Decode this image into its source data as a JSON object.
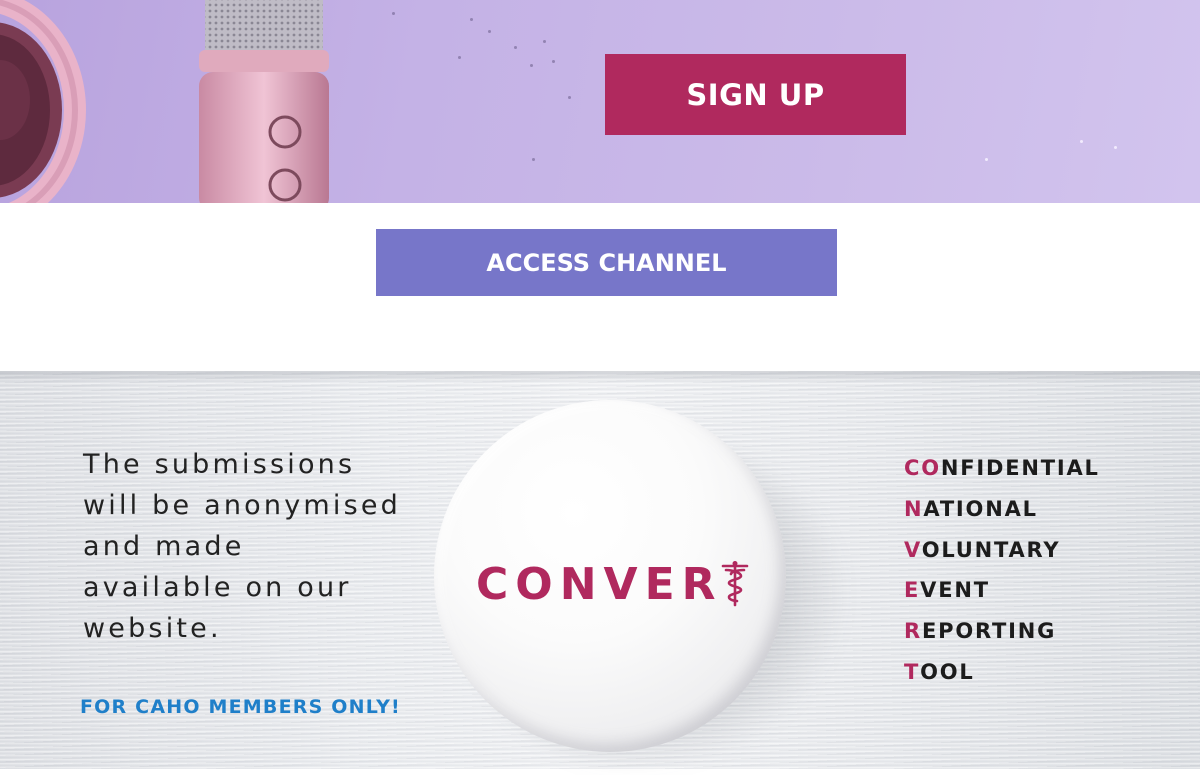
{
  "hero": {
    "signup_label": "SIGN UP"
  },
  "access": {
    "label": "ACCESS CHANNEL"
  },
  "convert": {
    "blurb_lines": [
      "The submissions",
      "will be anonymised",
      "and made",
      "available on our",
      "website."
    ],
    "members_only": "FOR CAHO MEMBERS ONLY!",
    "badge_word": "CONVER",
    "badge_icon": "caduceus-icon",
    "acronym": [
      {
        "highlight": "CO",
        "rest": "NFIDENTIAL"
      },
      {
        "highlight": "N",
        "rest": "ATIONAL"
      },
      {
        "highlight": "V",
        "rest": "OLUNTARY"
      },
      {
        "highlight": "E",
        "rest": "VENT"
      },
      {
        "highlight": "R",
        "rest": "EPORTING"
      },
      {
        "highlight": "T",
        "rest": "OOL"
      }
    ]
  },
  "colors": {
    "brand_magenta": "#b0295e",
    "access_purple": "#7776c9",
    "link_blue": "#1f7fc9",
    "hero_lavender": "#c4b2e6"
  }
}
